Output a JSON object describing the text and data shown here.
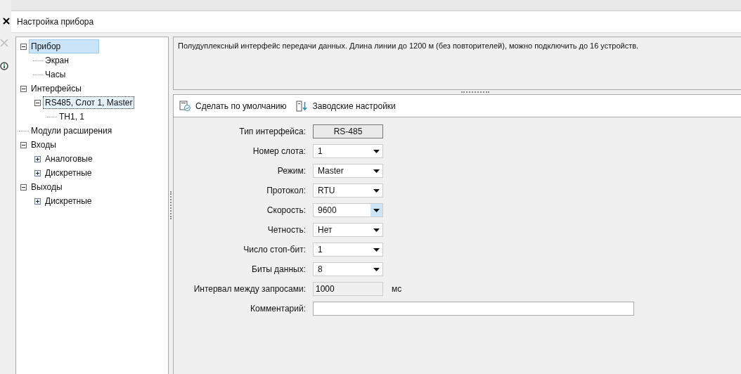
{
  "window": {
    "title": "Настройка прибора"
  },
  "tree": [
    {
      "label": "Прибор",
      "selected": true,
      "focused": false,
      "expanded": true,
      "children": [
        {
          "label": "Экран",
          "selected": false,
          "focused": false
        },
        {
          "label": "Часы",
          "selected": false,
          "focused": false
        }
      ]
    },
    {
      "label": "Интерфейсы",
      "selected": false,
      "focused": false,
      "expanded": true,
      "children": [
        {
          "label": "RS485, Слот 1, Master",
          "selected": false,
          "focused": true,
          "expanded": true,
          "children": [
            {
              "label": "ТН1, 1",
              "selected": false,
              "focused": false
            }
          ]
        }
      ]
    },
    {
      "label": "Модули расширения",
      "selected": false,
      "focused": false
    },
    {
      "label": "Входы",
      "selected": false,
      "focused": false,
      "expanded": true,
      "children": [
        {
          "label": "Аналоговые",
          "selected": false,
          "focused": false,
          "expanded": false
        },
        {
          "label": "Дискретные",
          "selected": false,
          "focused": false,
          "expanded": false
        }
      ]
    },
    {
      "label": "Выходы",
      "selected": false,
      "focused": false,
      "expanded": true,
      "children": [
        {
          "label": "Дискретные",
          "selected": false,
          "focused": false,
          "expanded": false
        }
      ]
    }
  ],
  "description": "Полудуплексный интерфейс передачи данных. Длина линии до 1200 м (без повторителей), можно подключить до 16 устройств.",
  "toolbar": [
    {
      "label": "Сделать по умолчанию",
      "kind": "default"
    },
    {
      "label": "Заводские настройки",
      "kind": "factory"
    }
  ],
  "fields": [
    {
      "label": "Тип интерфейса:",
      "kind": "readonly",
      "value": "RS-485"
    },
    {
      "label": "Номер слота:",
      "kind": "select",
      "value": "1",
      "hot": false
    },
    {
      "label": "Режим:",
      "kind": "select",
      "value": "Master",
      "hot": false
    },
    {
      "label": "Протокол:",
      "kind": "select",
      "value": "RTU",
      "hot": false
    },
    {
      "label": "Скорость:",
      "kind": "select",
      "value": "9600",
      "hot": true
    },
    {
      "label": "Четность:",
      "kind": "select",
      "value": "Нет",
      "hot": false
    },
    {
      "label": "Число стоп-бит:",
      "kind": "select",
      "value": "1",
      "hot": false
    },
    {
      "label": "Биты данных:",
      "kind": "select",
      "value": "8",
      "hot": false
    },
    {
      "label": "Интервал между запросами:",
      "kind": "number",
      "value": "1000",
      "unit": "мс"
    },
    {
      "label": "Комментарий:",
      "kind": "text"
    }
  ]
}
